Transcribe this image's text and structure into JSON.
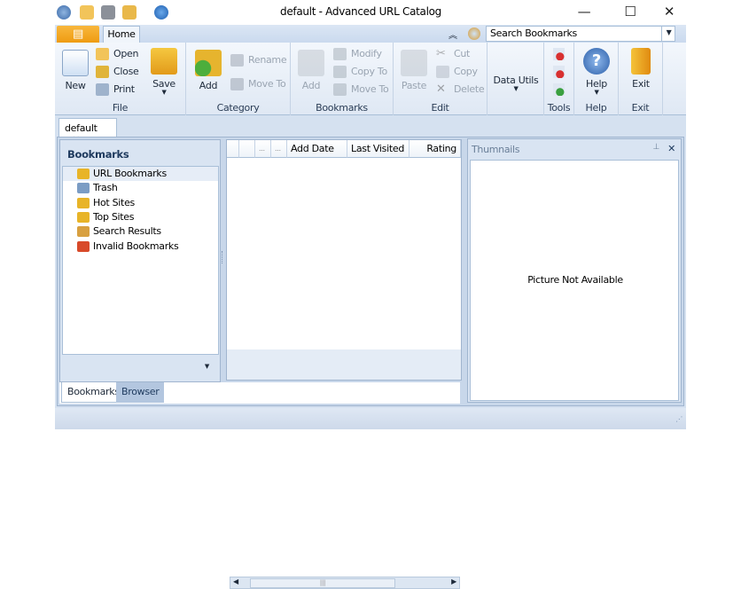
{
  "window": {
    "title": "default - Advanced URL Catalog",
    "minimize": "—",
    "maximize": "☐",
    "close": "✕"
  },
  "ribbon": {
    "tab": "Home",
    "search": {
      "placeholder": "Search Bookmarks"
    },
    "groups": {
      "file": {
        "label": "File",
        "new": "New",
        "open": "Open",
        "close": "Close",
        "print": "Print",
        "save": "Save"
      },
      "category": {
        "label": "Category",
        "add": "Add",
        "rename": "Rename",
        "move_to": "Move To"
      },
      "bookmarks": {
        "label": "Bookmarks",
        "add": "Add",
        "modify": "Modify",
        "copy_to": "Copy To",
        "move_to": "Move To"
      },
      "edit": {
        "label": "Edit",
        "paste": "Paste",
        "cut": "Cut",
        "copy": "Copy",
        "delete": "Delete"
      },
      "datautils": {
        "label": "Data Utils"
      },
      "tools": {
        "label": "Tools"
      },
      "help": {
        "label": "Help",
        "button": "Help"
      },
      "exit": {
        "label": "Exit",
        "button": "Exit"
      }
    }
  },
  "doc_tab": {
    "label": "default",
    "close": "✕"
  },
  "left_panel": {
    "title": "Bookmarks",
    "items": [
      {
        "label": "URL Bookmarks",
        "icon": "folder-icon",
        "color": "#e8b428"
      },
      {
        "label": "Trash",
        "icon": "trash-icon",
        "color": "#7b9cc4"
      },
      {
        "label": "Hot Sites",
        "icon": "folder-icon",
        "color": "#e8b428"
      },
      {
        "label": "Top Sites",
        "icon": "folder-icon",
        "color": "#e8b428"
      },
      {
        "label": "Search Results",
        "icon": "search-icon",
        "color": "#d8a040"
      },
      {
        "label": "Invalid Bookmarks",
        "icon": "invalid-folder-icon",
        "color": "#d84a2a"
      }
    ],
    "tabs": [
      "Bookmarks",
      "Browser"
    ]
  },
  "grid": {
    "columns": [
      "",
      "",
      "...",
      "...",
      "Add Date",
      "Last Visited",
      "Rating"
    ]
  },
  "thumbnails": {
    "title": "Thumnails",
    "pin": "⊥",
    "close": "✕",
    "empty_text": "Picture Not Available"
  }
}
